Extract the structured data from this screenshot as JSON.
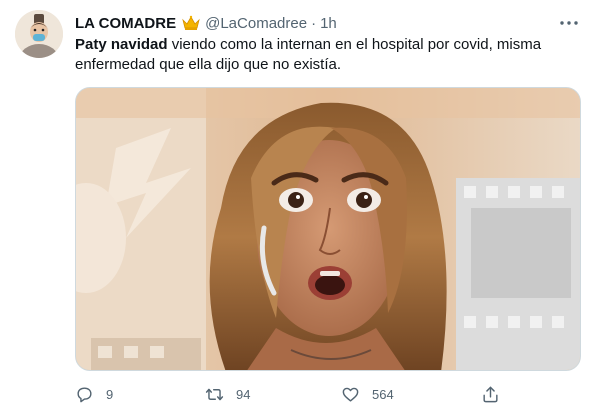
{
  "author": {
    "display_name": "LA COMADRE",
    "handle": "@LaComadree",
    "separator": "·",
    "time": "1h"
  },
  "tweet": {
    "highlight": "Paty navidad",
    "text_rest": " viendo como la internan en el hospital por covid, misma enfermedad que ella dijo que no existía."
  },
  "actions": {
    "reply_count": "9",
    "retweet_count": "94",
    "like_count": "564"
  },
  "icons": {
    "avatar": "avatar-icon",
    "crown": "crown-icon",
    "more": "more-icon",
    "reply": "reply-icon",
    "retweet": "retweet-icon",
    "like": "heart-icon",
    "share": "share-icon"
  },
  "colors": {
    "text": "#0f1419",
    "secondary": "#536471",
    "crown": "#f4b400",
    "border": "#cfd9de"
  }
}
